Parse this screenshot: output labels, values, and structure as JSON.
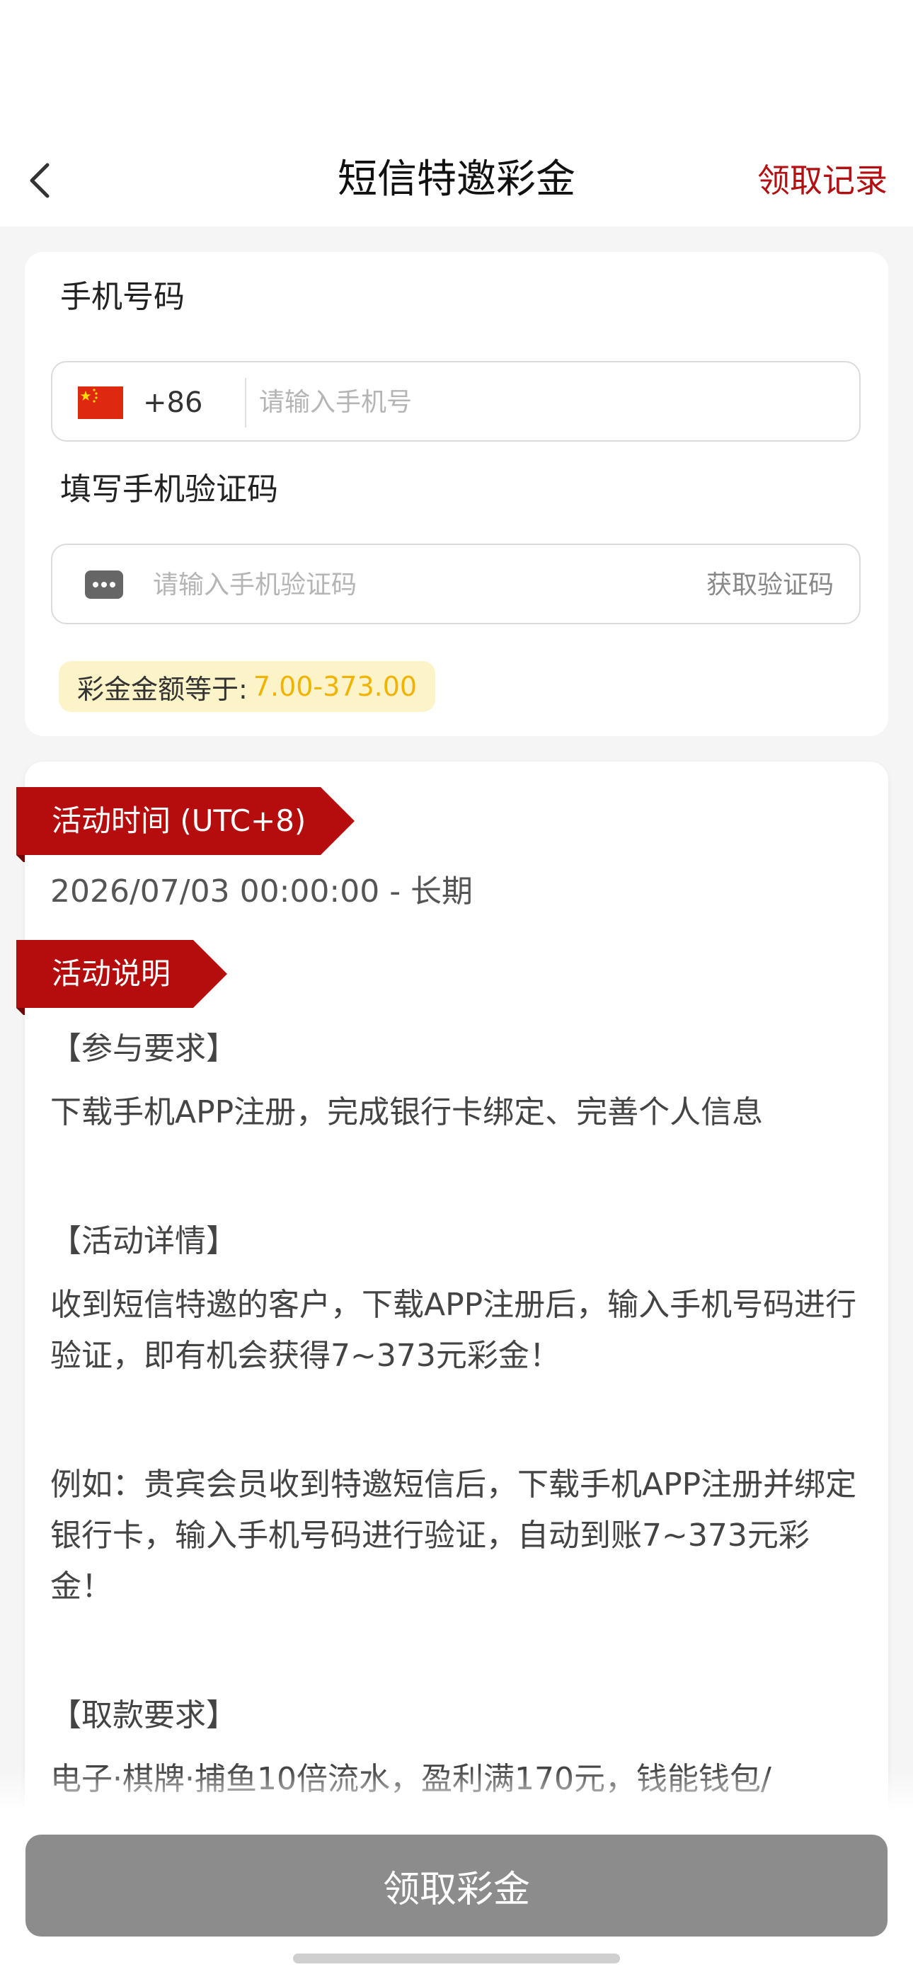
{
  "header": {
    "title": "短信特邀彩金",
    "right_link": "领取记录"
  },
  "form": {
    "phone_label": "手机号码",
    "country_code": "+86",
    "phone_placeholder": "请输入手机号",
    "code_label": "填写手机验证码",
    "code_placeholder": "请输入手机验证码",
    "get_code": "获取验证码",
    "amount_label": "彩金金额等于:",
    "amount_value": "7.00-373.00"
  },
  "activity": {
    "time_title": "活动时间 (UTC+8)",
    "time_value": "2026/07/03 00:00:00 - 长期",
    "desc_title": "活动说明",
    "paragraphs": [
      "【参与要求】",
      "下载手机APP注册，完成银行卡绑定、完善个人信息",
      "【活动详情】",
      "收到短信特邀的客户，下载APP注册后，输入手机号码进行验证，即有机会获得7~373元彩金！",
      "例如：贵宾会员收到特邀短信后，下载手机APP注册并绑定银行卡，输入手机号码进行验证，自动到账7~373元彩金！",
      "【取款要求】",
      "电子·棋牌·捕鱼10倍流水，盈利满170元，钱能钱包/"
    ]
  },
  "bottom": {
    "claim_button": "领取彩金"
  },
  "colors": {
    "accent_red": "#b30f10",
    "amount_yellow": "#f0b400",
    "button_gray": "#8c8c8c"
  }
}
